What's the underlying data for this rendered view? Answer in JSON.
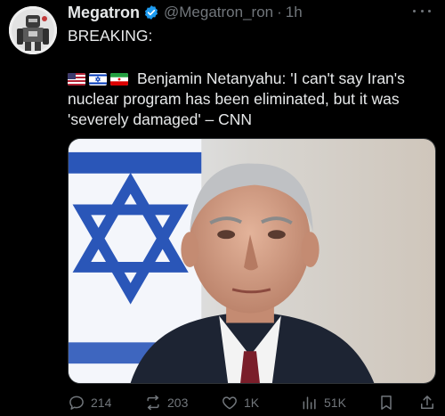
{
  "tweet": {
    "author_name": "Megatron",
    "author_handle": "@Megatron_ron",
    "separator": "·",
    "time": "1h",
    "text_line1": "BREAKING:",
    "flags": [
      "us-flag",
      "israel-flag",
      "iran-flag"
    ],
    "headline_part1": "Benjamin Netanyahu: 'I can't say Iran's",
    "headline_part2": "nuclear program has been eliminated, but it was",
    "headline_part3": "'severely damaged' – CNN",
    "media_alt": "photo"
  },
  "actions": {
    "replies": "214",
    "reposts": "203",
    "likes": "1K",
    "views": "51K"
  },
  "colors": {
    "background": "#000000",
    "text": "#e7e9ea",
    "muted": "#71767b",
    "verified_badge": "#1d9bf0"
  },
  "icons": [
    "verified-badge-icon",
    "more-icon",
    "reply-icon",
    "repost-icon",
    "like-icon",
    "views-icon",
    "bookmark-icon",
    "share-icon"
  ]
}
